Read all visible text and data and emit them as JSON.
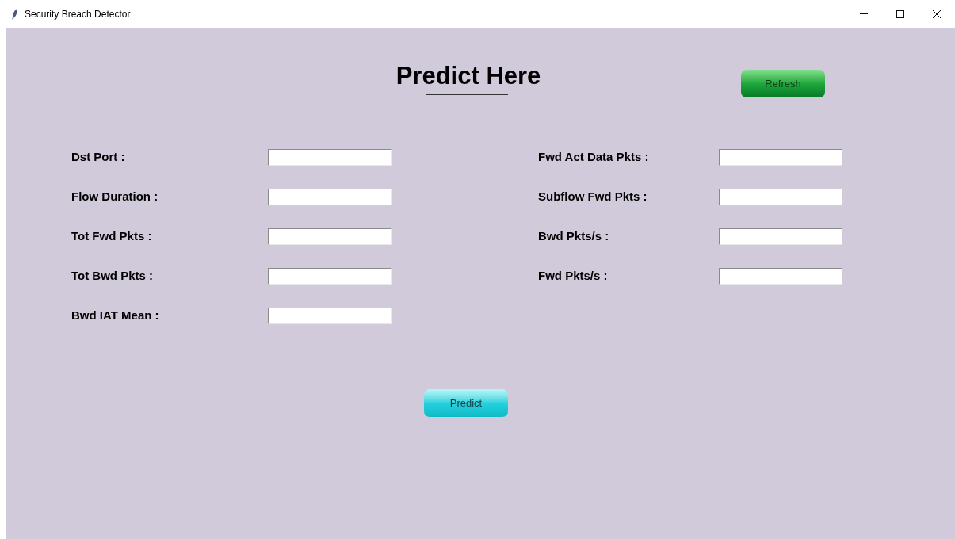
{
  "window": {
    "title": "Security Breach Detector"
  },
  "heading": "Predict Here",
  "refresh_button": "Refresh",
  "left_fields": [
    {
      "label": "Dst Port :"
    },
    {
      "label": "Flow Duration :"
    },
    {
      "label": "Tot Fwd Pkts :"
    },
    {
      "label": "Tot Bwd Pkts :"
    },
    {
      "label": "Bwd IAT Mean :"
    }
  ],
  "right_fields": [
    {
      "label": "Fwd Act Data Pkts :"
    },
    {
      "label": "Subflow Fwd Pkts :"
    },
    {
      "label": "Bwd Pkts/s :"
    },
    {
      "label": "Fwd Pkts/s :"
    }
  ],
  "predict_button": "Predict"
}
